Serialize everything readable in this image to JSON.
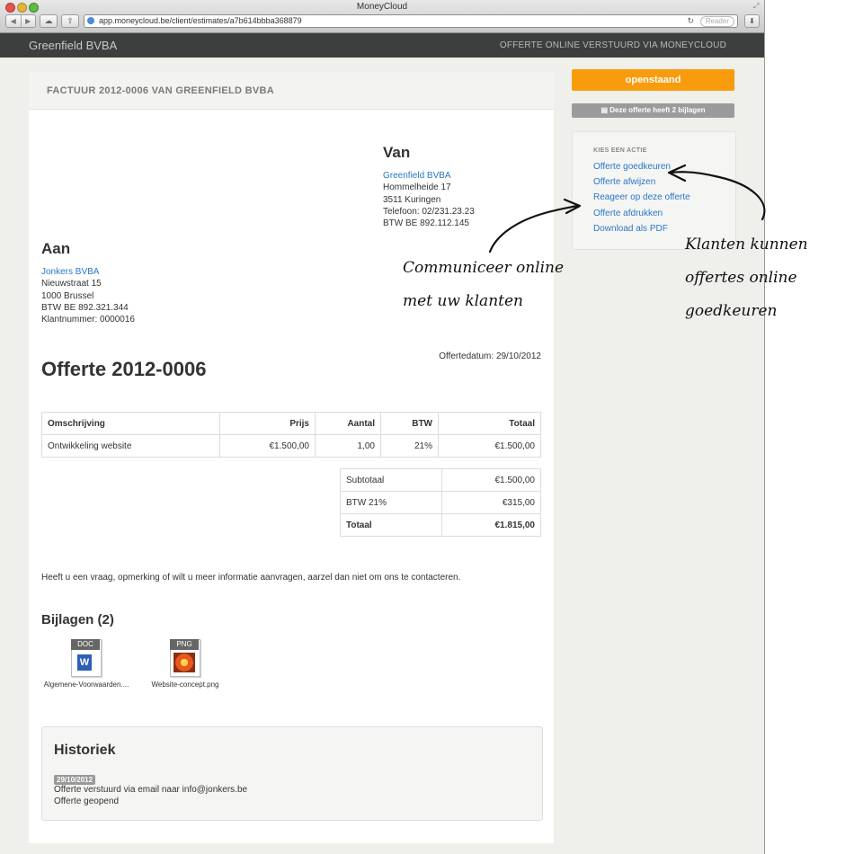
{
  "browser": {
    "window_title": "MoneyCloud",
    "url": "app.moneycloud.be/client/estimates/a7b614bbba368879",
    "reader_label": "Reader"
  },
  "header": {
    "brand": "Greenfield BVBA",
    "subtitle": "OFFERTE ONLINE VERSTUURD VIA MONEYCLOUD"
  },
  "document": {
    "card_title": "FACTUUR 2012-0006 VAN GREENFIELD BVBA",
    "from": {
      "heading": "Van",
      "name": "Greenfield BVBA",
      "lines": [
        "Hommelheide 17",
        "3511 Kuringen",
        "Telefoon: 02/231.23.23",
        "BTW BE 892.112.145"
      ]
    },
    "to": {
      "heading": "Aan",
      "name": "Jonkers BVBA",
      "lines": [
        "Nieuwstraat 15",
        "1000 Brussel",
        "BTW BE 892.321.344",
        "Klantnummer: 0000016"
      ]
    },
    "title": "Offerte 2012-0006",
    "date": "Offertedatum: 29/10/2012",
    "table": {
      "headers": [
        "Omschrijving",
        "Prijs",
        "Aantal",
        "BTW",
        "Totaal"
      ],
      "rows": [
        [
          "Ontwikkeling website",
          "€1.500,00",
          "1,00",
          "21%",
          "€1.500,00"
        ]
      ]
    },
    "totals": [
      [
        "Subtotaal",
        "€1.500,00"
      ],
      [
        "BTW 21%",
        "€315,00"
      ],
      [
        "Totaal",
        "€1.815,00"
      ]
    ],
    "note": "Heeft u een vraag, opmerking of wilt u meer informatie aanvragen, aarzel dan niet om ons te contacteren.",
    "attachments": {
      "heading": "Bijlagen (2)",
      "files": [
        {
          "name": "Algemene-Voorwaarden....",
          "type": "DOC"
        },
        {
          "name": "Website-concept.png",
          "type": "PNG"
        }
      ]
    },
    "history": {
      "heading": "Historiek",
      "date": "29/10/2012",
      "lines": [
        "Offerte verstuurd via email naar info@jonkers.be",
        "Offerte geopend"
      ]
    }
  },
  "sidebar": {
    "status": "openstaand",
    "attachments_button": "Deze offerte heeft 2 bijlagen",
    "actions_title": "KIES EEN ACTIE",
    "actions": [
      "Offerte goedkeuren",
      "Offerte afwijzen",
      "Reageer op deze offerte",
      "Offerte afdrukken",
      "Download als PDF"
    ]
  },
  "annotations": {
    "left": [
      "Communiceer online",
      "met uw klanten"
    ],
    "right": [
      "Klanten kunnen",
      "offertes online",
      "goedkeuren"
    ]
  },
  "colors": {
    "accent": "#f89b0c",
    "link": "#2a78c5",
    "header_bg": "#3d3e3e"
  }
}
